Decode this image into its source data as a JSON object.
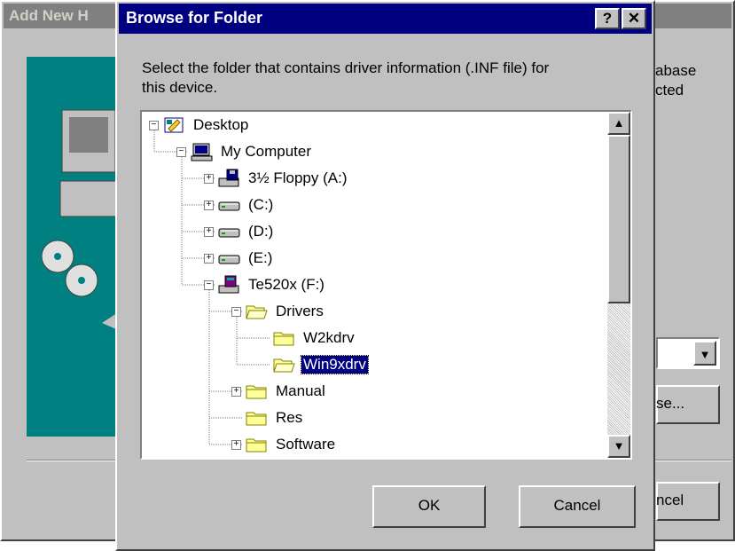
{
  "background_window": {
    "title": "Add New H",
    "text_line1": "abase",
    "text_line2": "cted",
    "browse_label": "se...",
    "cancel_label": "ncel"
  },
  "dialog": {
    "title": "Browse for Folder",
    "help_glyph": "?",
    "close_glyph": "✕",
    "instructions": "Select the folder that contains driver information (.INF file) for\nthis device.",
    "ok_label": "OK",
    "cancel_label": "Cancel"
  },
  "tree": [
    {
      "label": "Desktop",
      "icon": "desktop-icon",
      "expander": "−"
    },
    {
      "label": "My Computer",
      "icon": "computer-icon",
      "expander": "−"
    },
    {
      "label": "3½ Floppy (A:)",
      "icon": "floppy-drive-icon",
      "expander": "+"
    },
    {
      "label": "(C:)",
      "icon": "hard-drive-icon",
      "expander": "+"
    },
    {
      "label": "(D:)",
      "icon": "hard-drive-icon",
      "expander": "+"
    },
    {
      "label": "(E:)",
      "icon": "hard-drive-icon",
      "expander": "+"
    },
    {
      "label": "Te520x (F:)",
      "icon": "cdrom-drive-icon",
      "expander": "−"
    },
    {
      "label": "Drivers",
      "icon": "folder-open-icon",
      "expander": "−"
    },
    {
      "label": "W2kdrv",
      "icon": "folder-icon",
      "expander": ""
    },
    {
      "label": "Win9xdrv",
      "icon": "folder-open-icon",
      "expander": "",
      "selected": true
    },
    {
      "label": "Manual",
      "icon": "folder-icon",
      "expander": "+"
    },
    {
      "label": "Res",
      "icon": "folder-icon",
      "expander": ""
    },
    {
      "label": "Software",
      "icon": "folder-icon",
      "expander": "+"
    }
  ],
  "colors": {
    "titlebar_active": "#000080",
    "titlebar_inactive": "#808080",
    "face": "#c0c0c0",
    "teal": "#008080",
    "folder": "#ffff99"
  }
}
